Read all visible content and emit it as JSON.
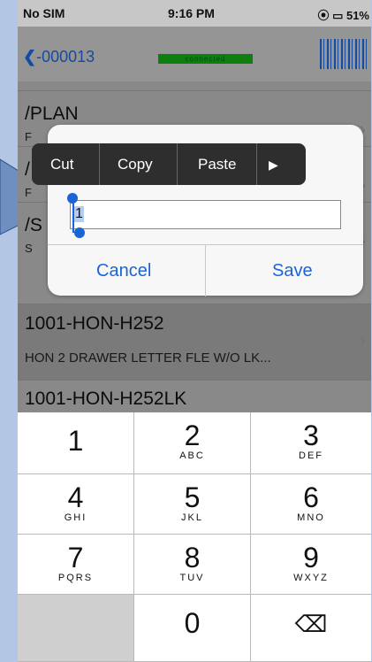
{
  "status": {
    "carrier": "No SIM",
    "time": "9:16 PM",
    "battery": "51%",
    "connection": "connected"
  },
  "nav": {
    "back_label": "-000013"
  },
  "list": [
    {
      "title": "/PLAN",
      "subtitle": "F"
    },
    {
      "title": "/",
      "subtitle": "F"
    },
    {
      "title": "/S",
      "subtitle": "S"
    },
    {
      "title": "1001-HON-H252",
      "subtitle": "HON 2 DRAWER LETTER FLE W/O LK..."
    },
    {
      "title": "1001-HON-H252LK",
      "subtitle": ""
    }
  ],
  "menu": {
    "cut": "Cut",
    "copy": "Copy",
    "paste": "Paste",
    "more": "▶"
  },
  "dialog": {
    "value": "1",
    "cancel": "Cancel",
    "save": "Save"
  },
  "keyboard": {
    "k1": "1",
    "k2": "2",
    "k2l": "ABC",
    "k3": "3",
    "k3l": "DEF",
    "k4": "4",
    "k4l": "GHI",
    "k5": "5",
    "k5l": "JKL",
    "k6": "6",
    "k6l": "MNO",
    "k7": "7",
    "k7l": "PQRS",
    "k8": "8",
    "k8l": "TUV",
    "k9": "9",
    "k9l": "WXYZ",
    "k0": "0",
    "del": "⌫"
  },
  "colors": {
    "accent": "#1a64d8",
    "connected": "#13a914",
    "menu_bg": "#2e2e2e"
  }
}
